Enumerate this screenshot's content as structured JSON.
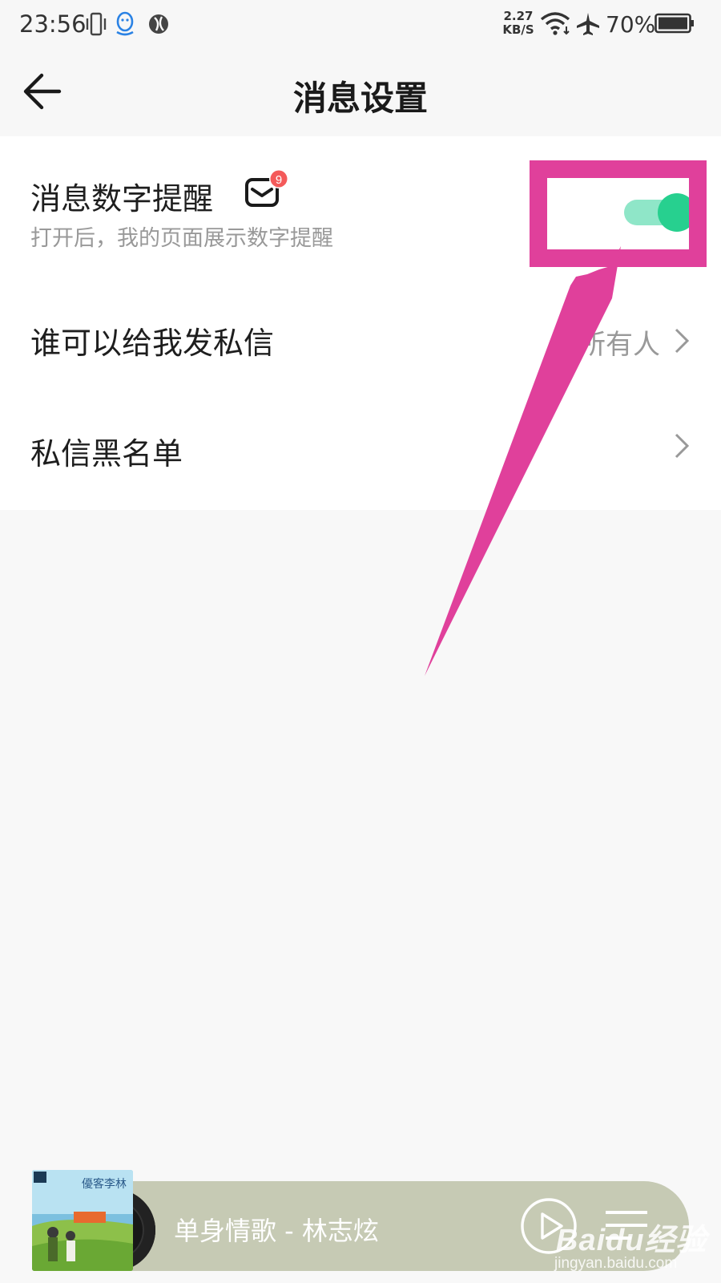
{
  "status_bar": {
    "time": "23:56",
    "net_speed_value": "2.27",
    "net_speed_unit": "KB/S",
    "battery": "70%",
    "icons": [
      "vibrate-icon",
      "qq-icon",
      "browser-icon",
      "wifi-icon",
      "airplane-icon",
      "battery-icon"
    ]
  },
  "header": {
    "title": "消息设置",
    "back_icon": "back-arrow-icon"
  },
  "settings": {
    "badge_reminder": {
      "title": "消息数字提醒",
      "subtitle": "打开后，我的页面展示数字提醒",
      "badge_count": "9",
      "enabled": true
    },
    "private_message": {
      "title": "谁可以给我发私信",
      "value": "所有人"
    },
    "blacklist": {
      "title": "私信黑名单"
    }
  },
  "player": {
    "song": "单身情歌 - 林志炫",
    "album_cover_text": "優客李林"
  },
  "watermark": {
    "logo": "Baidu经验",
    "url": "jingyan.baidu.com"
  },
  "colors": {
    "toggle_track": "#8fe6c8",
    "toggle_knob": "#27d08f",
    "annotation": "#e0409b",
    "badge": "#f45a5a",
    "player_bg": "#c6cab4"
  }
}
